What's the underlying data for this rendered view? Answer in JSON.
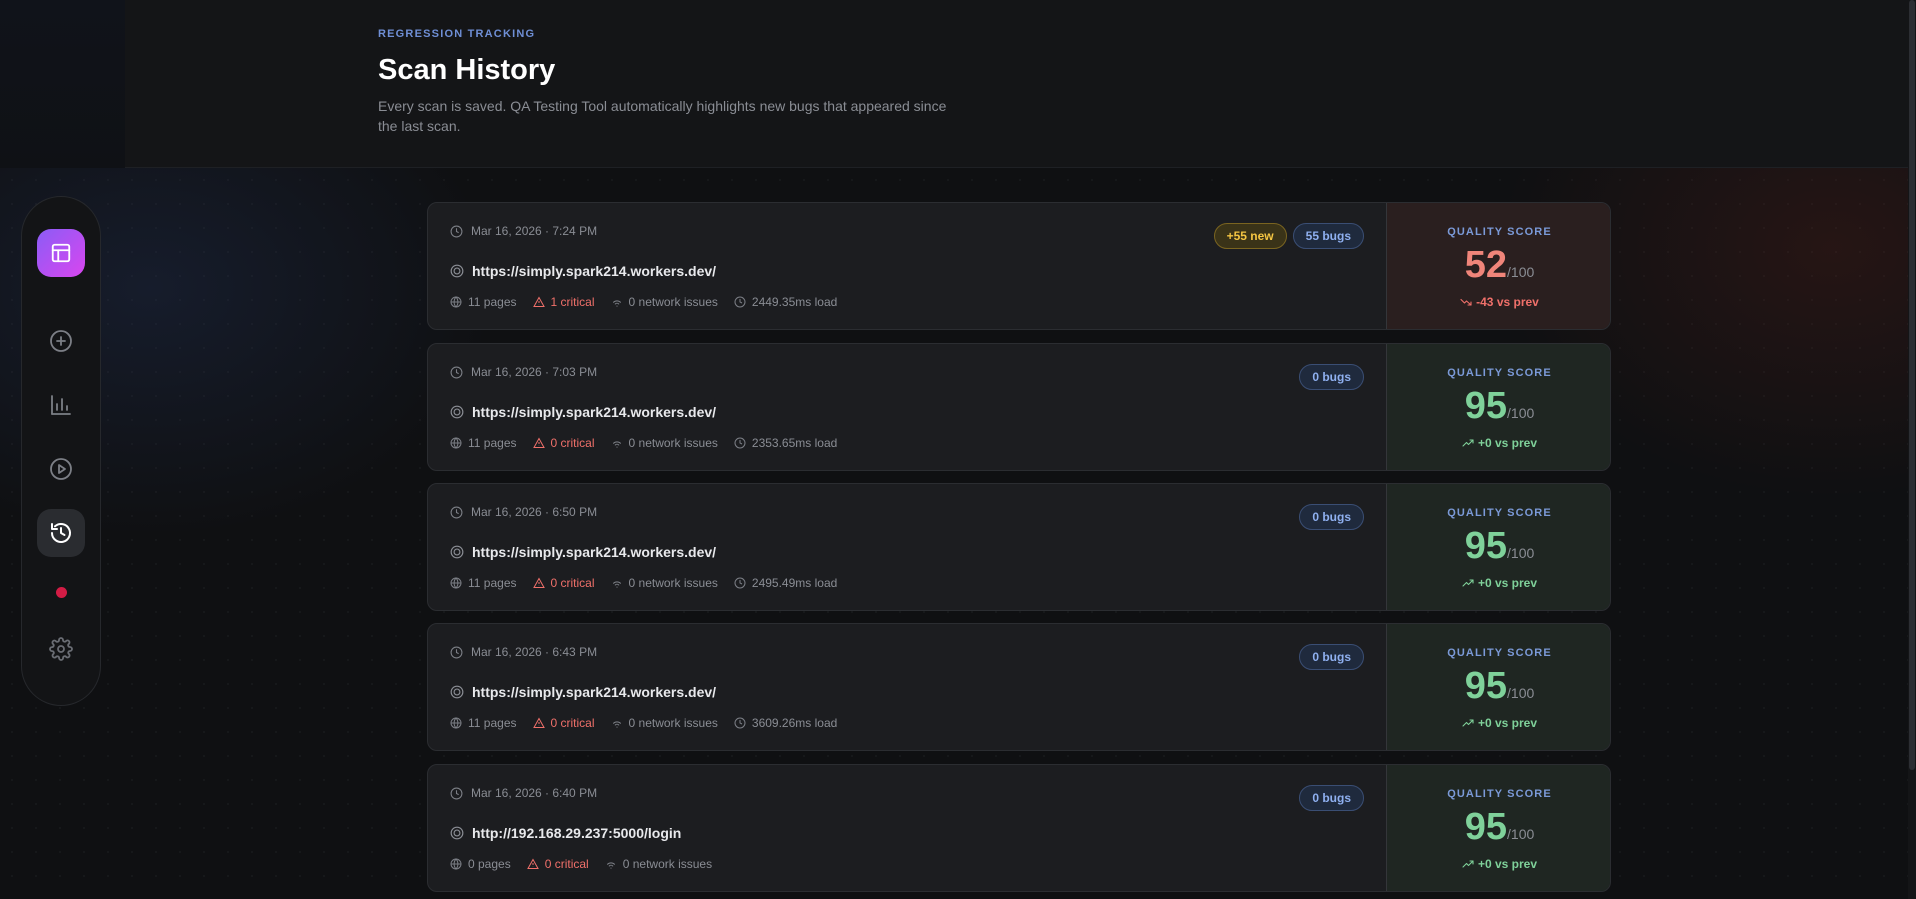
{
  "header": {
    "eyebrow": "REGRESSION TRACKING",
    "title": "Scan History",
    "subtitle": "Every scan is saved. QA Testing Tool automatically highlights new bugs that appeared since the last scan."
  },
  "sidebar": {
    "items": [
      {
        "icon": "layout-icon",
        "name": "dashboard"
      },
      {
        "icon": "plus-circle-icon",
        "name": "new-scan"
      },
      {
        "icon": "bar-chart-icon",
        "name": "analytics"
      },
      {
        "icon": "play-circle-icon",
        "name": "run"
      },
      {
        "icon": "history-icon",
        "name": "history",
        "active": true
      },
      {
        "icon": "record-dot-icon",
        "name": "recording"
      },
      {
        "icon": "gear-icon",
        "name": "settings"
      }
    ],
    "accent": "#6d5bf2",
    "record_color": "#d31c45"
  },
  "scans": [
    {
      "date": "Mar 16, 2026 · 7:24 PM",
      "url": "https://simply.spark214.workers.dev/",
      "pages": "11 pages",
      "critical": "1 critical",
      "network": "0 network issues",
      "load": "2449.35ms load",
      "new_badge": "+55 new",
      "bugs_badge": "55 bugs",
      "score_label": "QUALITY SCORE",
      "score": "52",
      "score_max": "/100",
      "delta": "-43 vs prev",
      "status": "bad"
    },
    {
      "date": "Mar 16, 2026 · 7:03 PM",
      "url": "https://simply.spark214.workers.dev/",
      "pages": "11 pages",
      "critical": "0 critical",
      "network": "0 network issues",
      "load": "2353.65ms load",
      "bugs_badge": "0 bugs",
      "score_label": "QUALITY SCORE",
      "score": "95",
      "score_max": "/100",
      "delta": "+0 vs prev",
      "status": "good"
    },
    {
      "date": "Mar 16, 2026 · 6:50 PM",
      "url": "https://simply.spark214.workers.dev/",
      "pages": "11 pages",
      "critical": "0 critical",
      "network": "0 network issues",
      "load": "2495.49ms load",
      "bugs_badge": "0 bugs",
      "score_label": "QUALITY SCORE",
      "score": "95",
      "score_max": "/100",
      "delta": "+0 vs prev",
      "status": "good"
    },
    {
      "date": "Mar 16, 2026 · 6:43 PM",
      "url": "https://simply.spark214.workers.dev/",
      "pages": "11 pages",
      "critical": "0 critical",
      "network": "0 network issues",
      "load": "3609.26ms load",
      "bugs_badge": "0 bugs",
      "score_label": "QUALITY SCORE",
      "score": "95",
      "score_max": "/100",
      "delta": "+0 vs prev",
      "status": "good"
    },
    {
      "date": "Mar 16, 2026 · 6:40 PM",
      "url": "http://192.168.29.237:5000/login",
      "pages": "0 pages",
      "critical": "0 critical",
      "network": "0 network issues",
      "bugs_badge": "0 bugs",
      "score_label": "QUALITY SCORE",
      "score": "95",
      "score_max": "/100",
      "delta": "+0 vs prev",
      "status": "good"
    }
  ],
  "colors": {
    "bad": "#f0857a",
    "good": "#7fd19a",
    "new_badge": "#f4c542",
    "bugs_badge": "#8fb0f0"
  }
}
